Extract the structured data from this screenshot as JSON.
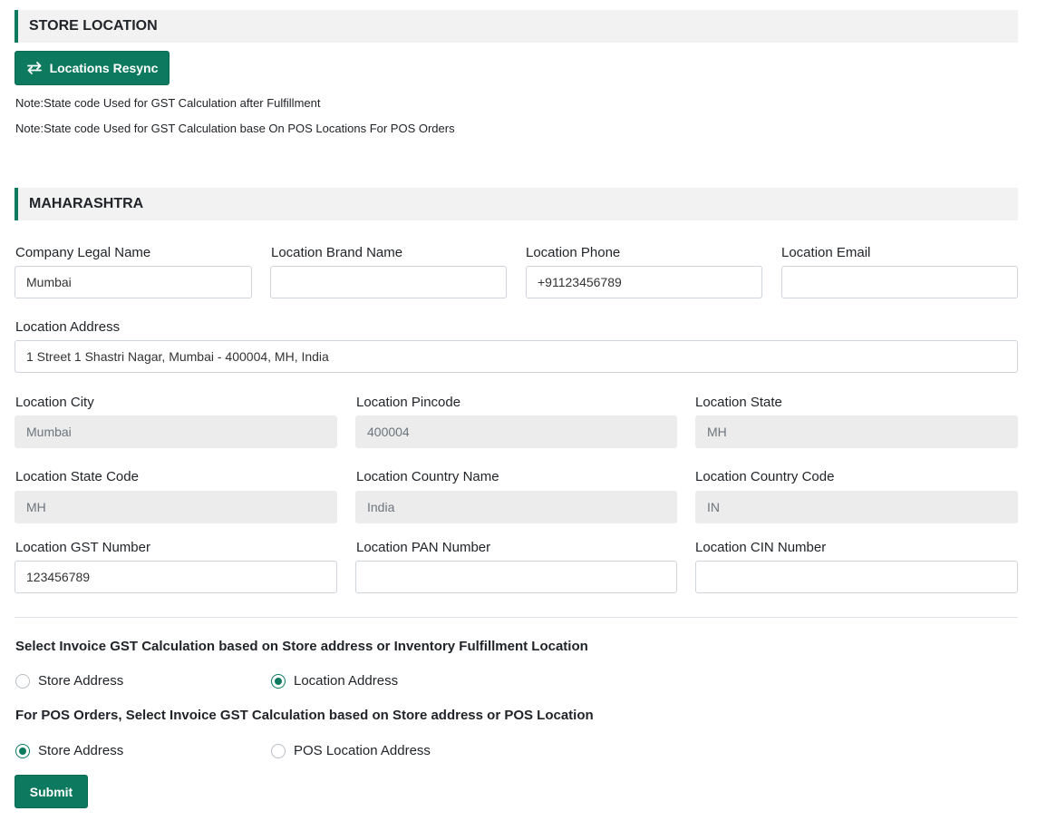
{
  "store_location": {
    "title": "STORE LOCATION",
    "resync_button": "Locations Resync",
    "resync_icon": "sync-arrows-icon",
    "notes": [
      "Note:State code Used for GST Calculation after Fulfillment",
      "Note:State code Used for GST Calculation base On POS Locations For POS Orders"
    ]
  },
  "location": {
    "title": "MAHARASHTRA",
    "fields": {
      "company_legal_name": {
        "label": "Company Legal Name",
        "value": "Mumbai"
      },
      "location_brand_name": {
        "label": "Location Brand Name",
        "value": ""
      },
      "location_phone": {
        "label": "Location Phone",
        "value": "+91123456789"
      },
      "location_email": {
        "label": "Location Email",
        "value": ""
      },
      "location_address": {
        "label": "Location Address",
        "value": "1 Street 1 Shastri Nagar, Mumbai - 400004, MH, India"
      },
      "location_city": {
        "label": "Location City",
        "value": "Mumbai"
      },
      "location_pincode": {
        "label": "Location Pincode",
        "value": "400004"
      },
      "location_state": {
        "label": "Location State",
        "value": "MH"
      },
      "location_state_code": {
        "label": "Location State Code",
        "value": "MH"
      },
      "location_country_name": {
        "label": "Location Country Name",
        "value": "India"
      },
      "location_country_code": {
        "label": "Location Country Code",
        "value": "IN"
      },
      "location_gst_number": {
        "label": "Location GST Number",
        "value": "123456789"
      },
      "location_pan_number": {
        "label": "Location PAN Number",
        "value": ""
      },
      "location_cin_number": {
        "label": "Location CIN Number",
        "value": ""
      }
    }
  },
  "invoice_gst": {
    "question": "Select Invoice GST Calculation based on Store address or Inventory Fulfillment Location",
    "options": [
      "Store Address",
      "Location Address"
    ],
    "selected": "Location Address"
  },
  "pos_gst": {
    "question": "For POS Orders, Select Invoice GST Calculation based on Store address or POS Location",
    "options": [
      "Store Address",
      "POS Location Address"
    ],
    "selected": "Store Address"
  },
  "submit_button": "Submit",
  "colors": {
    "accent": "#0d7a5f",
    "header_bg": "#f2f2f2",
    "disabled_bg": "#ececec"
  }
}
